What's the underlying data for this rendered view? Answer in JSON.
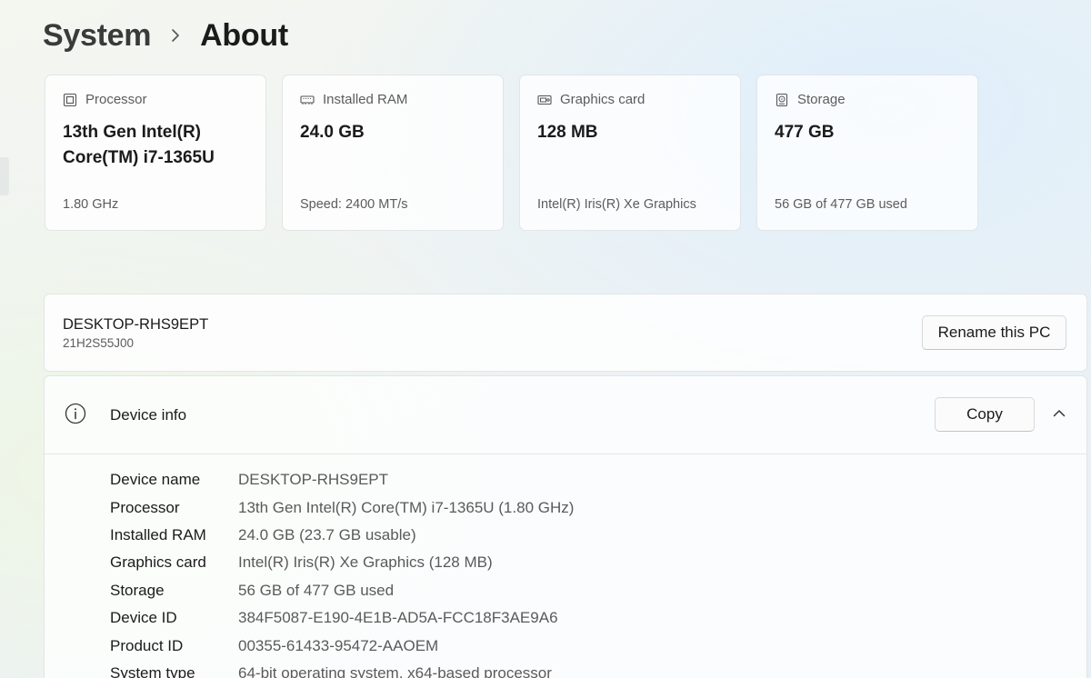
{
  "breadcrumb": {
    "parent": "System",
    "separator_icon": "chevron-right-icon",
    "current": "About"
  },
  "cards": [
    {
      "icon": "processor-icon",
      "label": "Processor",
      "value": "13th Gen Intel(R) Core(TM) i7-1365U",
      "sub": "1.80 GHz"
    },
    {
      "icon": "ram-icon",
      "label": "Installed RAM",
      "value": "24.0 GB",
      "sub": "Speed: 2400 MT/s"
    },
    {
      "icon": "graphics-card-icon",
      "label": "Graphics card",
      "value": "128 MB",
      "sub": "Intel(R) Iris(R) Xe Graphics"
    },
    {
      "icon": "storage-icon",
      "label": "Storage",
      "value": "477 GB",
      "sub": "56 GB of 477 GB used"
    }
  ],
  "pc": {
    "name": "DESKTOP-RHS9EPT",
    "model": "21H2S55J00",
    "rename_label": "Rename this PC"
  },
  "device_info": {
    "icon": "info-icon",
    "title": "Device info",
    "copy_label": "Copy",
    "collapse_icon": "chevron-up-icon",
    "specs": [
      {
        "label": "Device name",
        "value": "DESKTOP-RHS9EPT"
      },
      {
        "label": "Processor",
        "value": "13th Gen Intel(R) Core(TM) i7-1365U (1.80 GHz)"
      },
      {
        "label": "Installed RAM",
        "value": "24.0 GB (23.7 GB usable)"
      },
      {
        "label": "Graphics card",
        "value": "Intel(R) Iris(R) Xe Graphics (128 MB)"
      },
      {
        "label": "Storage",
        "value": "56 GB of 477 GB used"
      },
      {
        "label": "Device ID",
        "value": "384F5087-E190-4E1B-AD5A-FCC18F3AE9A6"
      },
      {
        "label": "Product ID",
        "value": "00355-61433-95472-AAOEM"
      },
      {
        "label": "System type",
        "value": "64-bit operating system, x64-based processor"
      }
    ]
  }
}
